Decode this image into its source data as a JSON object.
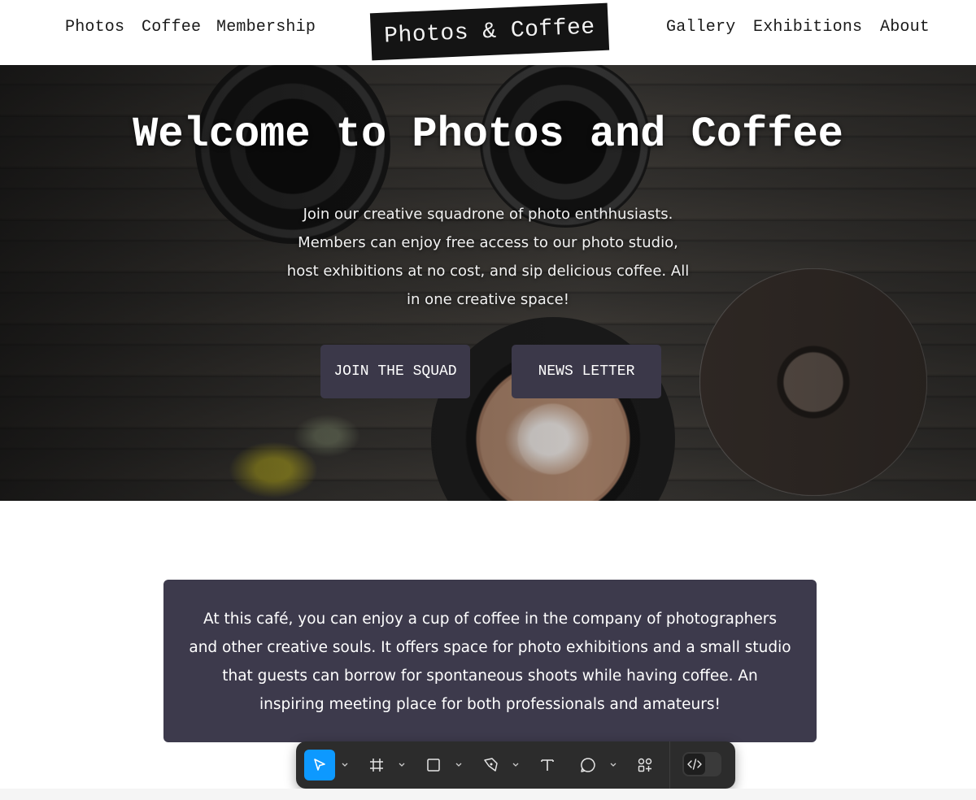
{
  "nav": {
    "left": [
      "Photos",
      "Coffee",
      "Membership"
    ],
    "logo": "Photos & Coffee",
    "right": [
      "Gallery",
      "Exhibitions",
      "About"
    ]
  },
  "hero": {
    "title": "Welcome to Photos and Coffee",
    "text": "Join our creative squadrone of photo enthhusiasts. Members can enjoy free access to our photo studio, host exhibitions at no cost, and sip delicious coffee. All in one creative space!",
    "buttons": {
      "join": "JOIN THE SQUAD",
      "newsletter": "NEWS LETTER"
    }
  },
  "info": {
    "text": "At this café, you can enjoy a cup of coffee in the company of photographers and other creative souls. It offers space for photo exhibitions and a small studio that guests can borrow for spontaneous shoots while having coffee. An inspiring meeting place for both professionals and amateurs!"
  },
  "toolbar": {
    "tools": [
      "move-icon",
      "frame-icon",
      "rectangle-icon",
      "pen-icon",
      "text-icon",
      "comment-icon",
      "actions-icon",
      "code-icon"
    ],
    "active_color": "#0d99ff"
  },
  "colors": {
    "button_bg": "#3b3849",
    "info_bg": "#3d3a4c",
    "logo_bg": "#141414"
  }
}
